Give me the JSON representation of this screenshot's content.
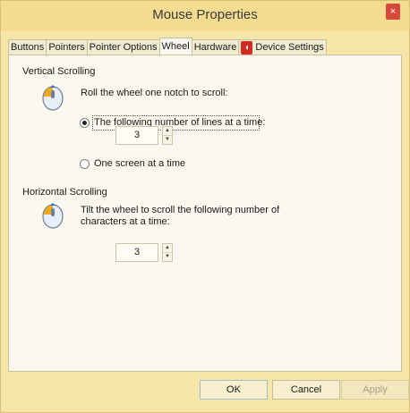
{
  "window": {
    "title": "Mouse Properties",
    "close_label": "×"
  },
  "tabs": [
    {
      "label": "Buttons",
      "active": false
    },
    {
      "label": "Pointers",
      "active": false
    },
    {
      "label": "Pointer Options",
      "active": false
    },
    {
      "label": "Wheel",
      "active": true
    },
    {
      "label": "Hardware",
      "active": false
    },
    {
      "label": "Device Settings",
      "active": false
    }
  ],
  "vertical": {
    "group_label": "Vertical Scrolling",
    "description": "Roll the wheel one notch to scroll:",
    "option_lines_label": "The following number of lines at a time:",
    "option_lines_selected": true,
    "lines_value": "3",
    "option_screen_label": "One screen at a time",
    "option_screen_selected": false
  },
  "horizontal": {
    "group_label": "Horizontal Scrolling",
    "description_line1": "Tilt the wheel to scroll the following number of",
    "description_line2": "characters at a time:",
    "chars_value": "3"
  },
  "buttons": {
    "ok": "OK",
    "cancel": "Cancel",
    "apply": "Apply"
  },
  "icons": {
    "wheel": "mouse-wheel-icon",
    "device": "device-settings-icon",
    "close": "close-icon"
  }
}
